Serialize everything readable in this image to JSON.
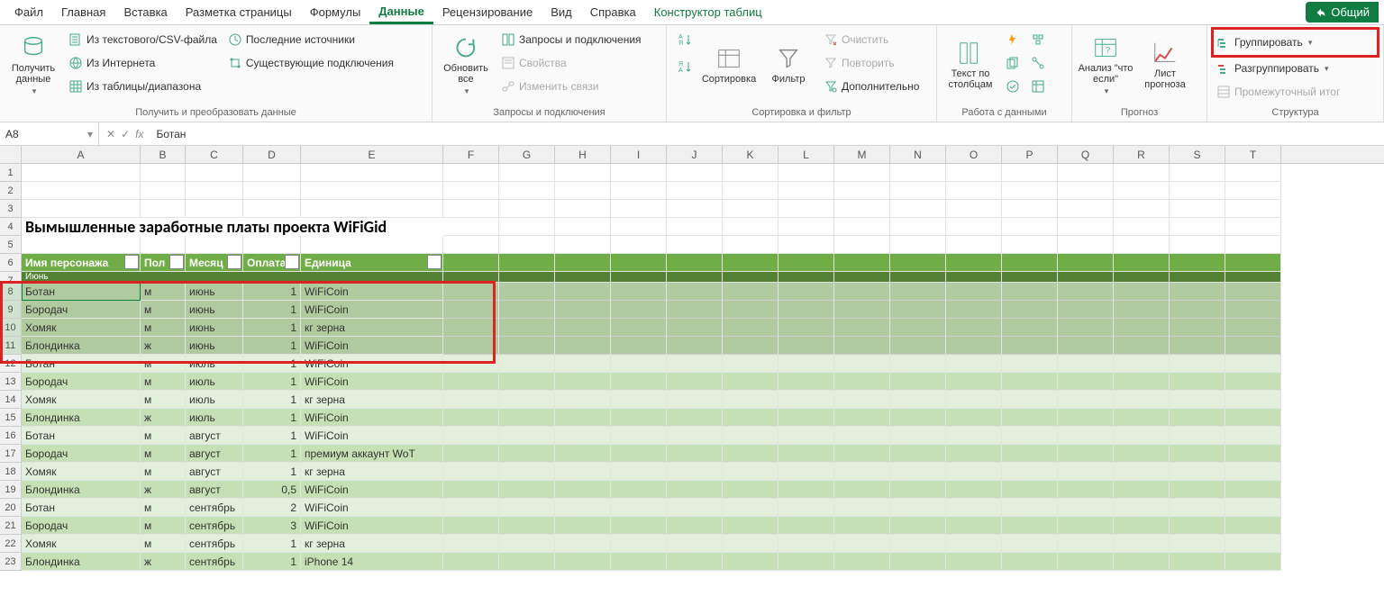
{
  "menu": {
    "tabs": [
      "Файл",
      "Главная",
      "Вставка",
      "Разметка страницы",
      "Формулы",
      "Данные",
      "Рецензирование",
      "Вид",
      "Справка",
      "Конструктор таблиц"
    ],
    "active": "Данные",
    "context": "Конструктор таблиц",
    "share": "Общий"
  },
  "ribbon": {
    "g1": {
      "label": "Получить и преобразовать данные",
      "get_data": "Получить данные",
      "from_csv": "Из текстового/CSV-файла",
      "from_web": "Из Интернета",
      "from_range": "Из таблицы/диапазона",
      "recent": "Последние источники",
      "existing": "Существующие подключения"
    },
    "g2": {
      "label": "Запросы и подключения",
      "refresh": "Обновить все",
      "queries": "Запросы и подключения",
      "props": "Свойства",
      "edit_links": "Изменить связи"
    },
    "g3": {
      "label": "Сортировка и фильтр",
      "sort": "Сортировка",
      "filter": "Фильтр",
      "clear": "Очистить",
      "reapply": "Повторить",
      "advanced": "Дополнительно"
    },
    "g4": {
      "label": "Работа с данными",
      "text_to_cols": "Текст по столбцам"
    },
    "g5": {
      "label": "Прогноз",
      "whatif": "Анализ \"что если\"",
      "forecast": "Лист прогноза"
    },
    "g6": {
      "label": "Структура",
      "group": "Группировать",
      "ungroup": "Разгруппировать",
      "subtotal": "Промежуточный итог"
    }
  },
  "formula_bar": {
    "name_box": "A8",
    "formula": "Ботан"
  },
  "sheet": {
    "columns": [
      "A",
      "B",
      "C",
      "D",
      "E",
      "F",
      "G",
      "H",
      "I",
      "J",
      "K",
      "L",
      "M",
      "N",
      "O",
      "P",
      "Q",
      "R",
      "S",
      "T"
    ],
    "title": "Вымышленные заработные платы проекта WiFiGid",
    "headers": [
      "Имя персонажа",
      "Пол",
      "Месяц",
      "Оплата",
      "Единица"
    ],
    "row7_label": "Июнь",
    "rows": [
      {
        "n": 8,
        "c": [
          "Ботан",
          "м",
          "июнь",
          "1",
          "WiFiCoin"
        ]
      },
      {
        "n": 9,
        "c": [
          "Бородач",
          "м",
          "июнь",
          "1",
          "WiFiCoin"
        ]
      },
      {
        "n": 10,
        "c": [
          "Хомяк",
          "м",
          "июнь",
          "1",
          "кг зерна"
        ]
      },
      {
        "n": 11,
        "c": [
          "Блондинка",
          "ж",
          "июнь",
          "1",
          "WiFiCoin"
        ]
      },
      {
        "n": 12,
        "c": [
          "Ботан",
          "м",
          "июль",
          "1",
          "WiFiCoin"
        ]
      },
      {
        "n": 13,
        "c": [
          "Бородач",
          "м",
          "июль",
          "1",
          "WiFiCoin"
        ]
      },
      {
        "n": 14,
        "c": [
          "Хомяк",
          "м",
          "июль",
          "1",
          "кг зерна"
        ]
      },
      {
        "n": 15,
        "c": [
          "Блондинка",
          "ж",
          "июль",
          "1",
          "WiFiCoin"
        ]
      },
      {
        "n": 16,
        "c": [
          "Ботан",
          "м",
          "август",
          "1",
          "WiFiCoin"
        ]
      },
      {
        "n": 17,
        "c": [
          "Бородач",
          "м",
          "август",
          "1",
          "премиум аккаунт WoT"
        ]
      },
      {
        "n": 18,
        "c": [
          "Хомяк",
          "м",
          "август",
          "1",
          "кг зерна"
        ]
      },
      {
        "n": 19,
        "c": [
          "Блондинка",
          "ж",
          "август",
          "0,5",
          "WiFiCoin"
        ]
      },
      {
        "n": 20,
        "c": [
          "Ботан",
          "м",
          "сентябрь",
          "2",
          "WiFiCoin"
        ]
      },
      {
        "n": 21,
        "c": [
          "Бородач",
          "м",
          "сентябрь",
          "3",
          "WiFiCoin"
        ]
      },
      {
        "n": 22,
        "c": [
          "Хомяк",
          "м",
          "сентябрь",
          "1",
          "кг зерна"
        ]
      },
      {
        "n": 23,
        "c": [
          "Блондинка",
          "ж",
          "сентябрь",
          "1",
          "iPhone 14"
        ]
      }
    ],
    "row_numbers_pre": [
      1,
      2,
      3,
      4,
      5,
      6,
      7
    ],
    "selected_rows": [
      8,
      9,
      10,
      11
    ]
  }
}
